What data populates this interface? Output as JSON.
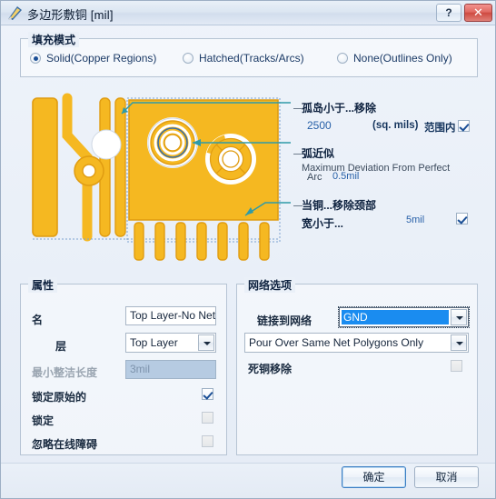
{
  "window": {
    "title": "多边形敷铜 [mil]",
    "icon": "polygon-pour-icon",
    "help_label": "?",
    "close_label": "✕"
  },
  "fill_mode": {
    "group_title": "填充模式",
    "options": [
      {
        "label": "Solid(Copper Regions)",
        "selected": true
      },
      {
        "label": "Hatched(Tracks/Arcs)",
        "selected": false
      },
      {
        "label": "None(Outlines Only)",
        "selected": false
      }
    ]
  },
  "annotations": {
    "islands": {
      "title": "孤岛小于...移除",
      "value": "2500",
      "unit": "(sq. mils)",
      "scope_label": "范围内",
      "checked": true
    },
    "arc_approx": {
      "title": "弧近似",
      "description_line1": "Maximum Deviation From Perfect",
      "description_line2_prefix": "Arc",
      "value": "0.5mil"
    },
    "necks": {
      "title": "当铜...移除颈部",
      "label": "宽小于...",
      "value": "5mil",
      "checked": true
    }
  },
  "properties": {
    "group_title": "属性",
    "name_label": "名",
    "name_value": "Top Layer-No Net",
    "layer_label": "层",
    "layer_value": "Top Layer",
    "min_prim_label": "最小整洁长度",
    "min_prim_value": "3mil",
    "lock_primitives_label": "锁定原始的",
    "lock_primitives_checked": true,
    "locked_label": "锁定",
    "locked_checked": false,
    "ignore_violations_label": "忽略在线障碍",
    "ignore_violations_checked": false
  },
  "net_options": {
    "group_title": "网络选项",
    "connect_label": "链接到网络",
    "connect_value": "GND",
    "pour_value": "Pour Over Same Net Polygons Only",
    "dead_copper_label": "死铜移除",
    "dead_copper_checked": false
  },
  "footer": {
    "ok_label": "确定",
    "cancel_label": "取消"
  },
  "colors": {
    "copper": "#f5b821",
    "copper_stroke": "#e09c11",
    "annotation_arrow": "#2e9aa8",
    "accent_blue": "#2760a8",
    "selection_blue": "#1a8cf0"
  }
}
